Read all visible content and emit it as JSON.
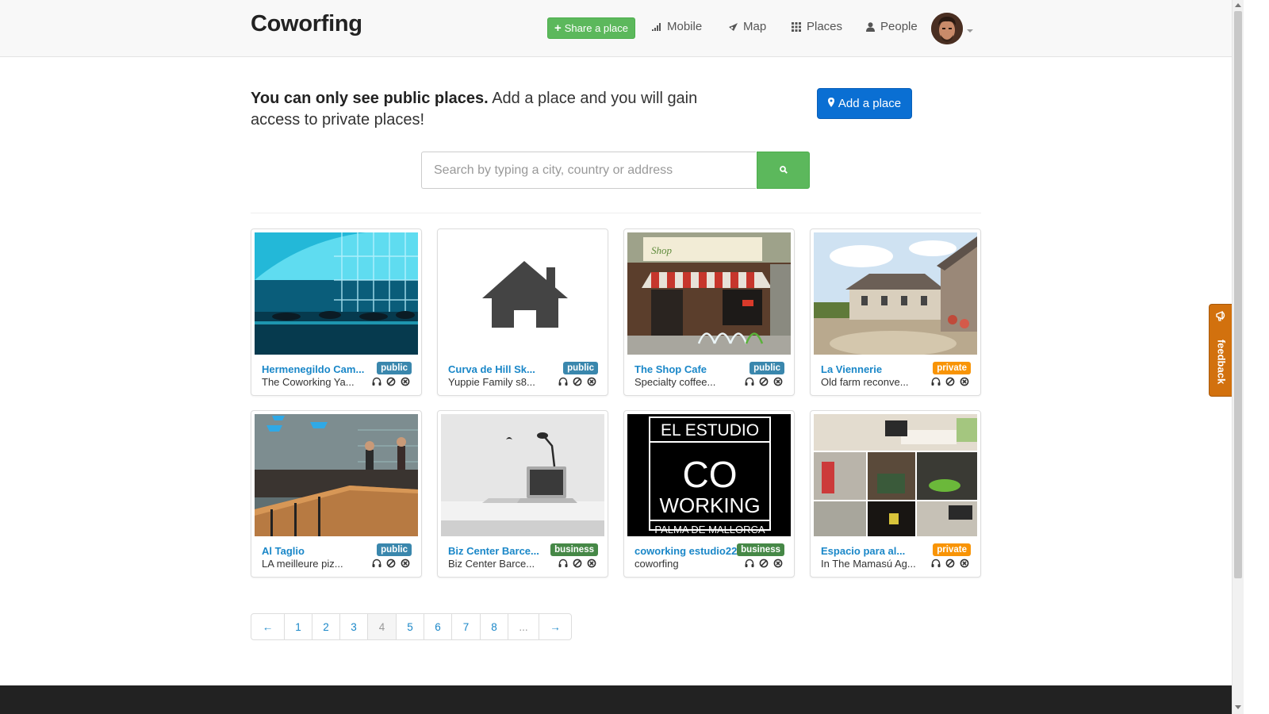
{
  "navbar": {
    "brand": "Coworfing",
    "share_label": "Share a place",
    "items": [
      {
        "label": "Mobile",
        "icon": "signal-icon"
      },
      {
        "label": "Map",
        "icon": "map-marker-icon"
      },
      {
        "label": "Places",
        "icon": "grid-icon"
      },
      {
        "label": "People",
        "icon": "user-icon"
      }
    ]
  },
  "intro": {
    "bold": "You can only see public places.",
    "text": " Add a place and you will gain access to private places!",
    "add_label": "Add a place"
  },
  "search": {
    "placeholder": "Search by typing a city, country or address",
    "value": ""
  },
  "places": [
    {
      "title": "Hermenegildo Cam...",
      "subtitle": "The Coworking Ya...",
      "badge": "public"
    },
    {
      "title": "Curva de Hill Sk...",
      "subtitle": "Yuppie Family s8...",
      "badge": "public"
    },
    {
      "title": "The Shop Cafe",
      "subtitle": "Specialty coffee...",
      "badge": "public"
    },
    {
      "title": "La Viennerie",
      "subtitle": "Old farm reconve...",
      "badge": "private"
    },
    {
      "title": "Al Taglio",
      "subtitle": "LA meilleure piz...",
      "badge": "public"
    },
    {
      "title": "Biz Center Barce...",
      "subtitle": "Biz Center Barce...",
      "badge": "business"
    },
    {
      "title": "coworking estudio22",
      "subtitle": "coworfing",
      "badge": "business"
    },
    {
      "title": "Espacio para al...",
      "subtitle": "In The Mamasú Ag...",
      "badge": "private"
    }
  ],
  "thumbs": {
    "shop_sign": "Shop",
    "estudio_line1": "EL ESTUDIO",
    "estudio_line2": "CO",
    "estudio_line3": "WORKING",
    "estudio_line4": "PALMA DE MALLORCA"
  },
  "pagination": {
    "prev": "←",
    "pages": [
      "1",
      "2",
      "3",
      "4",
      "5",
      "6",
      "7",
      "8"
    ],
    "active": "4",
    "ellipsis": "...",
    "next": "→"
  },
  "feedback": {
    "label": "feedback"
  },
  "colors": {
    "brand_green": "#5cb85c",
    "primary_blue": "#0a6fd3",
    "link_blue": "#1a87c8",
    "badge_public": "#3a87ad",
    "badge_private": "#f89406",
    "badge_business": "#468847",
    "feedback_orange": "#d2710e"
  }
}
